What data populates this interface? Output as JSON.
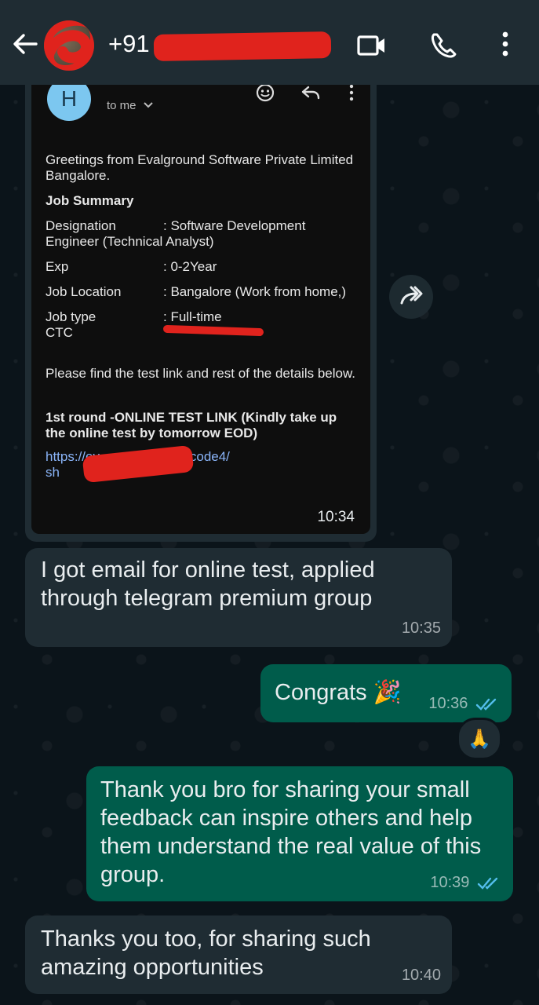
{
  "header": {
    "contact_prefix": "+91",
    "icons": [
      "back-arrow-icon",
      "video-call-icon",
      "voice-call-icon",
      "more-vert-icon"
    ]
  },
  "email": {
    "avatar_letter": "H",
    "to_line": "to me",
    "greeting": "Greetings from Evalground Software Private Limited Bangalore.",
    "summary_title": "Job Summary",
    "rows": [
      {
        "key": "Designation",
        "value": ": Software Development Engineer (Technical Analyst)"
      },
      {
        "key": "Exp",
        "value": ": 0-2Year"
      },
      {
        "key": "Job Location",
        "value": ": Bangalore (Work from home,)"
      },
      {
        "key": "Job type",
        "value": ": Full-time"
      },
      {
        "key": "CTC",
        "value": ""
      }
    ],
    "instructions": "Please find the test link and rest of the details below.",
    "round_title": "1st round -ONLINE TEST LINK (Kindly take up the online test by tomorrow EOD)",
    "link_line1": "https://ev",
    "link_line1_end": "m/code4/",
    "link_line2": "sh",
    "time": "10:34"
  },
  "messages": [
    {
      "dir": "in",
      "text": "I got email for online test, applied through telegram premium group",
      "time": "10:35"
    },
    {
      "dir": "out",
      "text": "Congrats 🎉",
      "time": "10:36",
      "status": "read"
    },
    {
      "dir": "out",
      "text": "Thank you bro for sharing your small feedback can inspire others and help them understand the real value of this group.",
      "time": "10:39",
      "status": "read"
    },
    {
      "dir": "in",
      "text": "Thanks you too, for sharing such amazing opportunities",
      "time": "10:40"
    }
  ],
  "reaction": "🙏",
  "colors": {
    "background": "#0b141a",
    "header": "#1f2c33",
    "incoming_bubble": "#1f2c33",
    "outgoing_bubble": "#005c4b",
    "read_ticks": "#53bdeb",
    "redaction": "#e0231d"
  }
}
